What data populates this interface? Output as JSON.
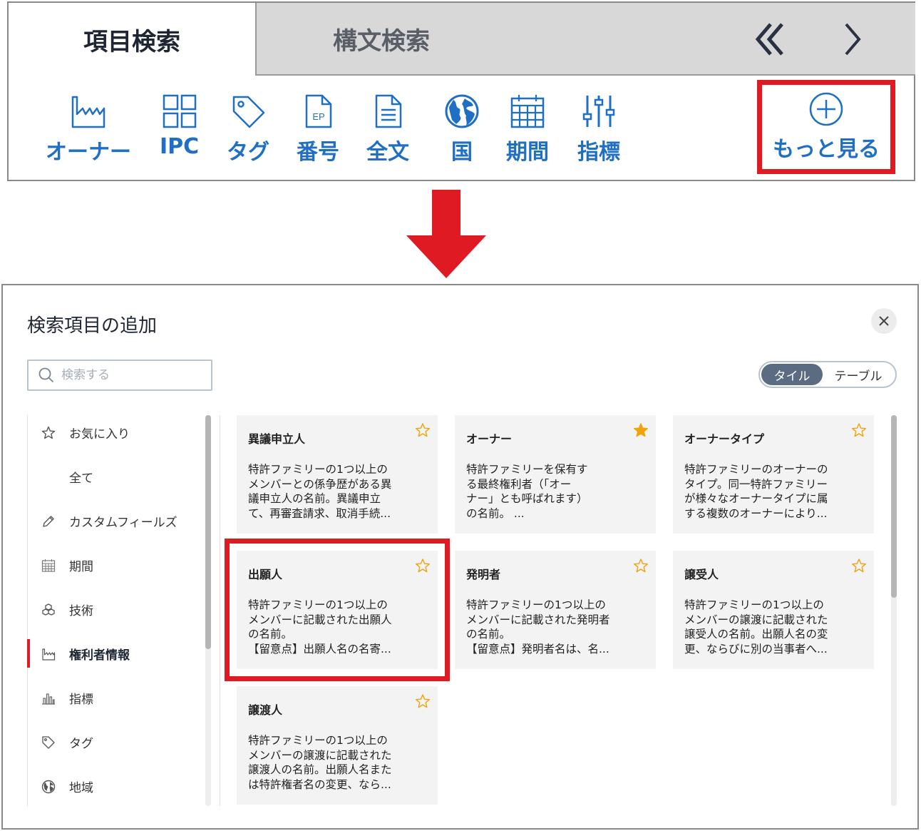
{
  "top_panel": {
    "tab_item_search": "項目検索",
    "tab_syntax_search": "構文検索",
    "tools": [
      {
        "label": "オーナー",
        "icon": "factory-icon"
      },
      {
        "label": "IPC",
        "icon": "grid-icon"
      },
      {
        "label": "タグ",
        "icon": "tag-icon"
      },
      {
        "label": "番号",
        "icon": "ep-document-icon"
      },
      {
        "label": "全文",
        "icon": "document-icon"
      },
      {
        "label": "国",
        "icon": "globe-icon"
      },
      {
        "label": "期間",
        "icon": "calendar-icon"
      },
      {
        "label": "指標",
        "icon": "sliders-icon"
      }
    ],
    "more_label": "もっと見る"
  },
  "dialog": {
    "title": "検索項目の追加",
    "search_placeholder": "検索する",
    "view_toggle": {
      "tile": "タイル",
      "table": "テーブル",
      "selected": "タイル"
    },
    "sidebar": [
      {
        "label": "お気に入り",
        "icon": "star-outline-icon"
      },
      {
        "label": "全て",
        "icon": ""
      },
      {
        "label": "カスタムフィールズ",
        "icon": "pencil-icon"
      },
      {
        "label": "期間",
        "icon": "calendar-icon"
      },
      {
        "label": "技術",
        "icon": "cubes-icon"
      },
      {
        "label": "権利者情報",
        "icon": "factory-icon",
        "selected": true
      },
      {
        "label": "指標",
        "icon": "bar-chart-icon"
      },
      {
        "label": "タグ",
        "icon": "tag-icon"
      },
      {
        "label": "地域",
        "icon": "globe-icon"
      }
    ],
    "cards": [
      {
        "title": "異議申立人",
        "desc": "特許ファミリーの1つ以上の\nメンバーとの係争歴がある異\n議申立人の名前。異議申立\nて、再審査請求、取消手続...",
        "starred": false
      },
      {
        "title": "オーナー",
        "desc": "特許ファミリーを保有す\nる最終権利者（「オー\nナー」とも呼ばれます）\nの名前。 ...",
        "starred": true
      },
      {
        "title": "オーナータイプ",
        "desc": "特許ファミリーのオーナーの\nタイプ。同一特許ファミリー\nが様々なオーナータイプに属\nする複数のオーナーにより...",
        "starred": false
      },
      {
        "title": "出願人",
        "desc": "特許ファミリーの1つ以上の\nメンバーに記載された出願人\nの名前。\n【留意点】出願人名の名寄...",
        "starred": false,
        "highlighted": true
      },
      {
        "title": "発明者",
        "desc": "特許ファミリーの1つ以上の\nメンバーに記載された発明者\nの名前。\n【留意点】発明者名は、名...",
        "starred": false
      },
      {
        "title": "譲受人",
        "desc": "特許ファミリーの1つ以上の\nメンバーの譲渡に記載された\n譲受人の名前。出願人名の変\n更、ならびに別の当事者へ...",
        "starred": false
      },
      {
        "title": "譲渡人",
        "desc": "特許ファミリーの1つ以上の\nメンバーの譲渡に記載された\n譲渡人の名前。出願人名また\nは特許権者名の変更、なら...",
        "starred": false
      }
    ]
  },
  "colors": {
    "accent_red": "#e01a22",
    "link_blue": "#1f6fc4",
    "star_gold": "#f0a30a"
  }
}
